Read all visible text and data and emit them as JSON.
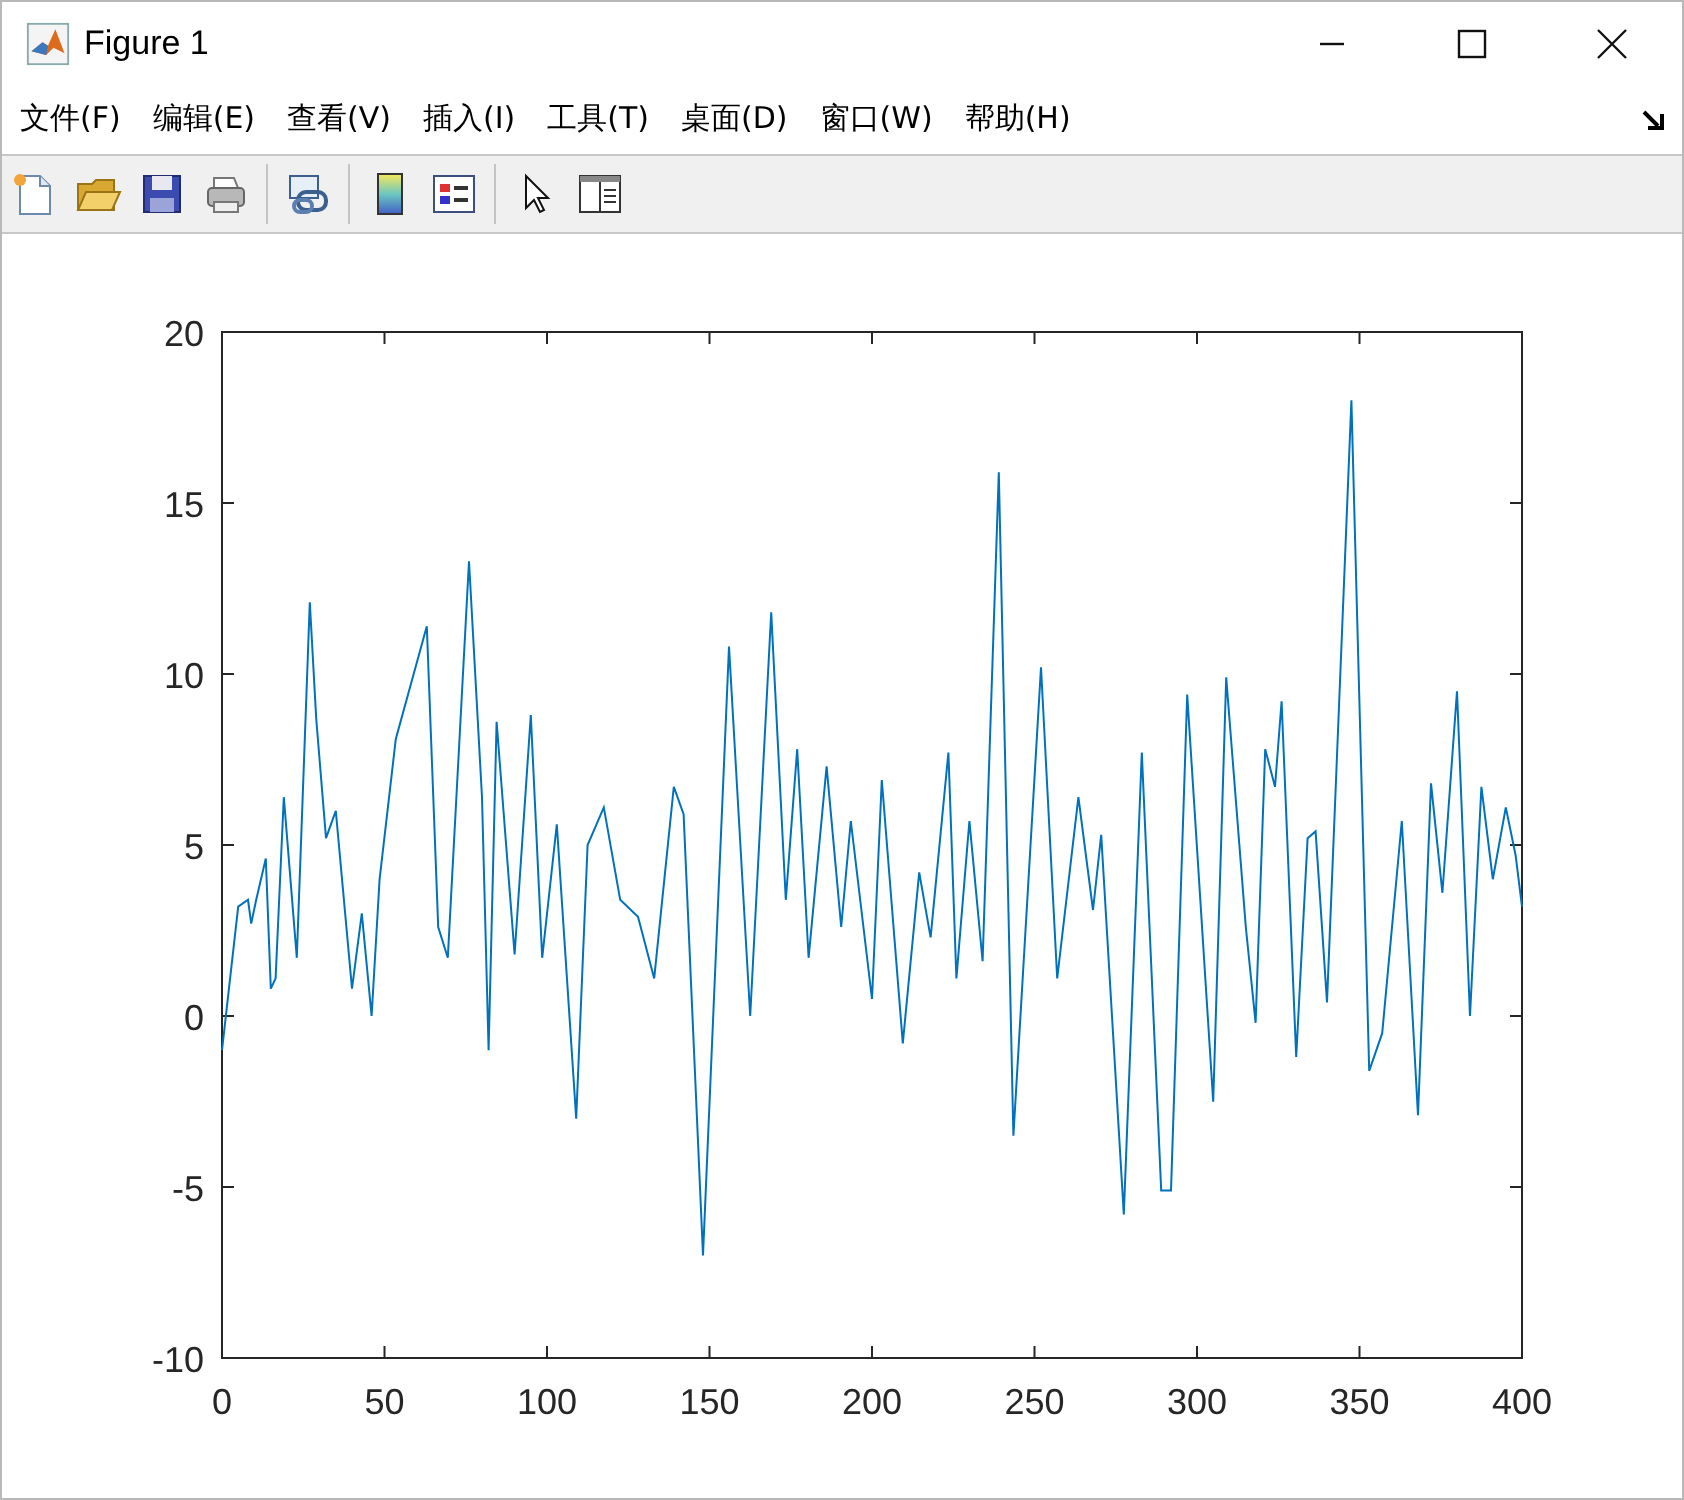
{
  "window": {
    "title": "Figure 1"
  },
  "menu_bar": [
    "文件(F)",
    "编辑(E)",
    "查看(V)",
    "插入(I)",
    "工具(T)",
    "桌面(D)",
    "窗口(W)",
    "帮助(H)"
  ],
  "axes": {
    "chart_data": {
      "type": "line",
      "xlim": [
        0,
        400
      ],
      "ylim": [
        -10,
        20
      ],
      "xticks": [
        0,
        50,
        100,
        150,
        200,
        250,
        300,
        350,
        400
      ],
      "yticks": [
        -10,
        -5,
        0,
        5,
        10,
        15,
        20
      ],
      "x": [
        0,
        5,
        8,
        9,
        10.5,
        13.5,
        15,
        16.5,
        19,
        23,
        27,
        29,
        32,
        35,
        40,
        43,
        46,
        48.5,
        53.5,
        63,
        66.5,
        69.5,
        76,
        80,
        82,
        84.5,
        90,
        95,
        98.5,
        103,
        109,
        112.5,
        117.5,
        122.5,
        128,
        133,
        139,
        142,
        148,
        156,
        162.5,
        169,
        173.5,
        177,
        180.5,
        186,
        190.5,
        193.5,
        200,
        203,
        209.5,
        214.5,
        218,
        223.5,
        226,
        230,
        234,
        239,
        243.5,
        252,
        257,
        263.5,
        268,
        270.5,
        277.5,
        283,
        289,
        292,
        297,
        305,
        309,
        315,
        318,
        321,
        324,
        326,
        330.5,
        334,
        336.5,
        340,
        347.5,
        353,
        357,
        363,
        368,
        372,
        375.5,
        380,
        384,
        387.5,
        391,
        395,
        398,
        400
      ],
      "series": [
        {
          "color": "#0072bd",
          "values": [
            -1,
            3.2,
            3.4,
            2.7,
            3.4,
            4.6,
            0.8,
            1.1,
            6.4,
            1.7,
            12.1,
            8.7,
            5.2,
            6,
            0.8,
            3,
            0,
            4,
            8.1,
            11.4,
            2.6,
            1.7,
            13.3,
            6.4,
            -1,
            8.6,
            1.8,
            8.8,
            1.7,
            5.6,
            -3,
            5,
            6.1,
            3.4,
            2.9,
            1.1,
            6.7,
            5.9,
            -7,
            10.8,
            0,
            11.8,
            3.4,
            7.8,
            1.7,
            7.3,
            2.6,
            5.7,
            0.5,
            6.9,
            -0.8,
            4.2,
            2.3,
            7.7,
            1.1,
            5.7,
            1.6,
            15.9,
            -3.5,
            10.2,
            1.1,
            6.4,
            3.1,
            5.3,
            -5.8,
            7.7,
            -5.1,
            -5.1,
            9.4,
            -2.5,
            9.9,
            2.6,
            -0.2,
            7.8,
            6.7,
            9.2,
            -1.2,
            5.2,
            5.4,
            0.4,
            18,
            -1.6,
            -0.5,
            5.7,
            -2.9,
            6.8,
            3.6,
            9.5,
            0,
            6.7,
            4,
            6.1,
            4.7,
            3.2
          ]
        }
      ]
    }
  }
}
